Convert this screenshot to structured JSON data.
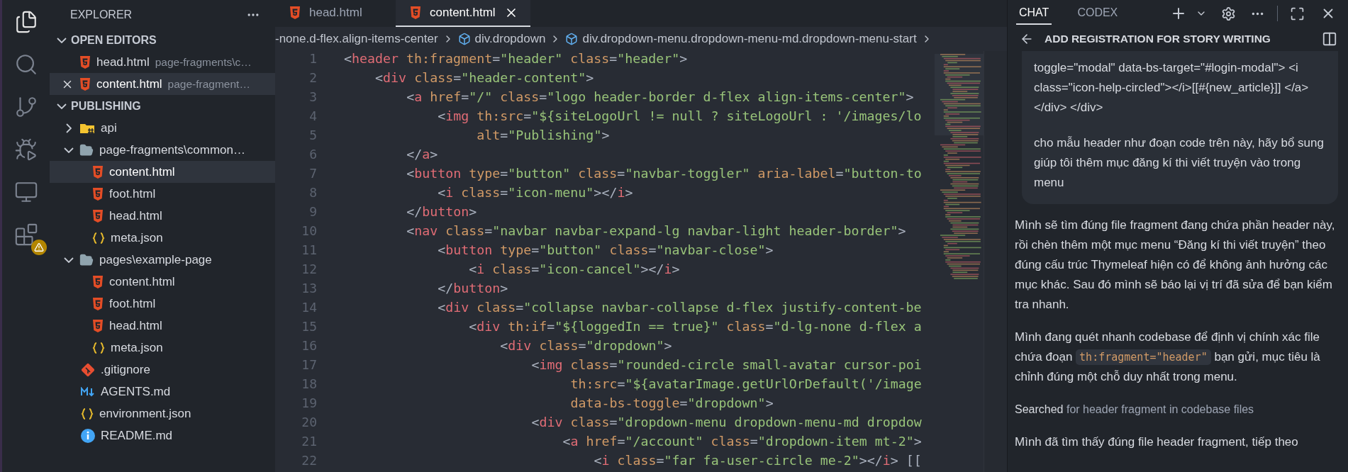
{
  "activity_bar": [
    {
      "kind": "files",
      "selected": true,
      "warning": false
    },
    {
      "kind": "search",
      "selected": false,
      "warning": false
    },
    {
      "kind": "source-control",
      "selected": false,
      "warning": false
    },
    {
      "kind": "run-debug",
      "selected": false,
      "warning": false
    },
    {
      "kind": "remote",
      "selected": false,
      "warning": false
    },
    {
      "kind": "extensions",
      "selected": false,
      "warning": true
    }
  ],
  "sidebar": {
    "title": "EXPLORER",
    "open_editors": {
      "title": "OPEN EDITORS",
      "expanded": true,
      "items": [
        {
          "name": "head.html",
          "path": "page-fragments\\c…",
          "kind": "html",
          "selected": false
        },
        {
          "name": "content.html",
          "path": "page-fragment…",
          "kind": "html",
          "selected": true
        }
      ]
    },
    "workspace": {
      "title": "PUBLISHING",
      "expanded": true,
      "items": [
        {
          "name": "api",
          "kind": "api-folder",
          "expanded": false,
          "selected": false
        },
        {
          "name": "page-fragments\\common…",
          "kind": "folder",
          "expanded": true,
          "selected": false,
          "children": [
            {
              "name": "content.html",
              "kind": "html",
              "selected": true
            },
            {
              "name": "foot.html",
              "kind": "html",
              "selected": false
            },
            {
              "name": "head.html",
              "kind": "html",
              "selected": false
            },
            {
              "name": "meta.json",
              "kind": "json",
              "selected": false
            }
          ]
        },
        {
          "name": "pages\\example-page",
          "kind": "folder",
          "expanded": true,
          "selected": false,
          "children": [
            {
              "name": "content.html",
              "kind": "html",
              "selected": false
            },
            {
              "name": "foot.html",
              "kind": "html",
              "selected": false
            },
            {
              "name": "head.html",
              "kind": "html",
              "selected": false
            },
            {
              "name": "meta.json",
              "kind": "json",
              "selected": false
            }
          ]
        },
        {
          "name": ".gitignore",
          "kind": "git",
          "selected": false
        },
        {
          "name": "AGENTS.md",
          "kind": "md",
          "selected": false
        },
        {
          "name": "environment.json",
          "kind": "json",
          "selected": false
        },
        {
          "name": "README.md",
          "kind": "info",
          "selected": false
        }
      ]
    }
  },
  "editor": {
    "tabs": [
      {
        "label": "head.html",
        "selected": false
      },
      {
        "label": "content.html",
        "selected": true
      }
    ],
    "breadcrumb": [
      {
        "text": "-none.d-flex.align-items-center",
        "kind": "plain"
      },
      {
        "text": "div.dropdown",
        "kind": "element"
      },
      {
        "text": "div.dropdown-menu.dropdown-menu-md.dropdown-menu-start",
        "kind": "element"
      }
    ],
    "lines": [
      {
        "number": "1",
        "code": "<header th:fragment=\"header\" class=\"header\">"
      },
      {
        "number": "2",
        "code": "    <div class=\"header-content\">"
      },
      {
        "number": "3",
        "code": "        <a href=\"/\" class=\"logo header-border d-flex align-items-center\">"
      },
      {
        "number": "4",
        "code": "            <img th:src=\"${siteLogoUrl != null ? siteLogoUrl : '/images/lo"
      },
      {
        "number": "5",
        "code": "                 alt=\"Publishing\">"
      },
      {
        "number": "6",
        "code": "        </a>"
      },
      {
        "number": "7",
        "code": "        <button type=\"button\" class=\"navbar-toggler\" aria-label=\"button-to"
      },
      {
        "number": "8",
        "code": "            <i class=\"icon-menu\"></i>"
      },
      {
        "number": "9",
        "code": "        </button>"
      },
      {
        "number": "10",
        "code": "        <nav class=\"navbar navbar-expand-lg navbar-light header-border\">"
      },
      {
        "number": "11",
        "code": "            <button type=\"button\" class=\"navbar-close\">"
      },
      {
        "number": "12",
        "code": "                <i class=\"icon-cancel\"></i>"
      },
      {
        "number": "13",
        "code": "            </button>"
      },
      {
        "number": "14",
        "code": "            <div class=\"collapse navbar-collapse d-flex justify-content-be"
      },
      {
        "number": "15",
        "code": "                <div th:if=\"${loggedIn == true}\" class=\"d-lg-none d-flex a"
      },
      {
        "number": "16",
        "code": "                    <div class=\"dropdown\">"
      },
      {
        "number": "17",
        "code": "                        <img class=\"rounded-circle small-avatar cursor-poi"
      },
      {
        "number": "18",
        "code": "                             th:src=\"${avatarImage.getUrlOrDefault('/image"
      },
      {
        "number": "19",
        "code": "                             data-bs-toggle=\"dropdown\">"
      },
      {
        "number": "20",
        "code": "                        <div class=\"dropdown-menu dropdown-menu-md dropdow"
      },
      {
        "number": "21",
        "code": "                            <a href=\"/account\" class=\"dropdown-item mt-2\">"
      },
      {
        "number": "22",
        "code": "                                <i class=\"far fa-user-circle me-2\"></i> [["
      }
    ]
  },
  "chat": {
    "tabs": [
      {
        "label": "CHAT",
        "selected": true
      },
      {
        "label": "CODEX",
        "selected": false
      }
    ],
    "title": "ADD REGISTRATION FOR STORY WRITING",
    "user_message": [
      "toggle=\"modal\" data-bs-target=\"#login-modal\"> <i class=\"icon-help-circled\"></i>[[#{new_article}]] </a> </div> </div>",
      "cho mẫu header như đoạn code trên này, hãy bổ sung giúp tôi thêm mục đăng kí thi viết truyện vào trong menu"
    ],
    "messages": [
      {
        "kind": "text",
        "text": "Mình sẽ tìm đúng file fragment đang chứa phần header này, rồi chèn thêm một mục menu “Đăng kí thi viết truyện” theo đúng cấu trúc Thymeleaf hiện có để không ảnh hưởng các mục khác. Sau đó mình sẽ báo lại vị trí đã sửa để bạn kiểm tra nhanh."
      },
      {
        "kind": "text-with-code",
        "before": "Mình đang quét nhanh codebase để định vị chính xác file chứa đoạn",
        "code": "th:fragment=\"header\"",
        "after": "bạn gửi, mục tiêu là chỉnh đúng một chỗ duy nhất trong menu."
      },
      {
        "kind": "activity",
        "verb": "Searched",
        "detail": "for header fragment in codebase files"
      },
      {
        "kind": "text",
        "text": "Mình đã tìm thấy đúng file header fragment, tiếp theo"
      }
    ]
  }
}
